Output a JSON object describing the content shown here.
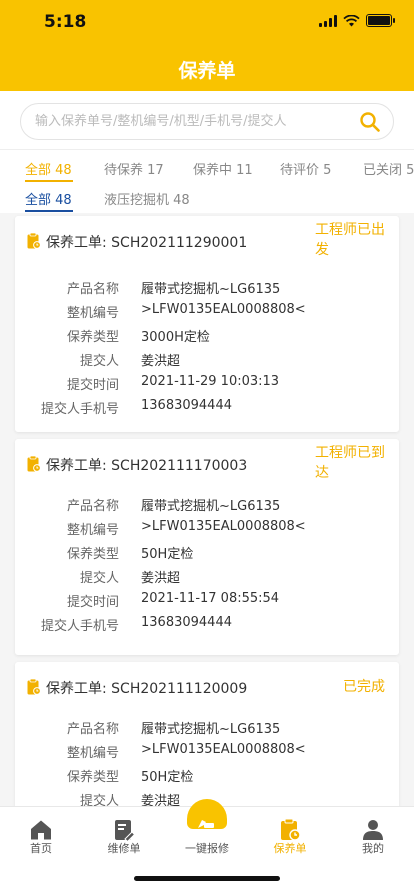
{
  "status_bar": {
    "time": "5:18"
  },
  "header": {
    "title": "保养单"
  },
  "search": {
    "placeholder": "输入保养单号/整机编号/机型/手机号/提交人"
  },
  "status_tabs": [
    "全部 48",
    "待保养 17",
    "保养中 11",
    "待评价 5",
    "已关闭 5"
  ],
  "type_tabs": [
    "全部 48",
    "液压挖掘机 48"
  ],
  "labels": {
    "order": "保养工单:",
    "product": "产品名称",
    "serial": "整机编号",
    "type": "保养类型",
    "submitter": "提交人",
    "time": "提交时间",
    "phone": "提交人手机号"
  },
  "orders": [
    {
      "id": "SCH202111290001",
      "status": "工程师已出发",
      "product": "履带式挖掘机~LG6135",
      "serial": ">LFW0135EAL0008808<",
      "type": "3000H定检",
      "submitter": "姜洪超",
      "time": "2021-11-29 10:03:13",
      "phone": "13683094444"
    },
    {
      "id": "SCH202111170003",
      "status": "工程师已到达",
      "product": "履带式挖掘机~LG6135",
      "serial": ">LFW0135EAL0008808<",
      "type": "50H定检",
      "submitter": "姜洪超",
      "time": "2021-11-17 08:55:54",
      "phone": "13683094444"
    },
    {
      "id": "SCH202111120009",
      "status": "已完成",
      "product": "履带式挖掘机~LG6135",
      "serial": ">LFW0135EAL0008808<",
      "type": "50H定检",
      "submitter": "姜洪超"
    }
  ],
  "tabbar": [
    "首页",
    "维修单",
    "一键报修",
    "保养单",
    "我的"
  ],
  "colors": {
    "brand": "#f9c300",
    "accent": "#f2b100",
    "type_tab_active": "#1a4fa0"
  }
}
